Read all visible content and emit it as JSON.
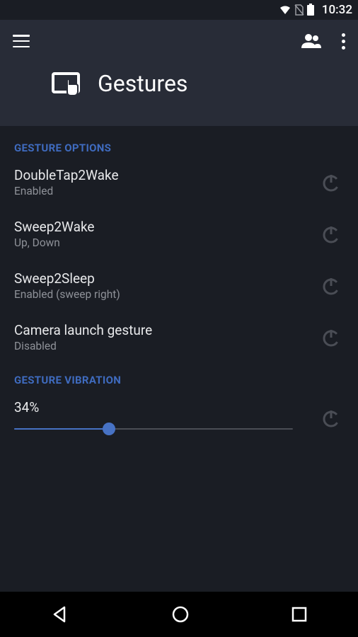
{
  "status_bar": {
    "time": "10:32"
  },
  "header": {
    "title": "Gestures"
  },
  "sections": {
    "options_header": "GESTURE OPTIONS",
    "vibration_header": "GESTURE VIBRATION"
  },
  "settings": {
    "doubletap": {
      "title": "DoubleTap2Wake",
      "sub": "Enabled"
    },
    "sweep2wake": {
      "title": "Sweep2Wake",
      "sub": "Up, Down"
    },
    "sweep2sleep": {
      "title": "Sweep2Sleep",
      "sub": "Enabled (sweep right)"
    },
    "camera": {
      "title": "Camera launch gesture",
      "sub": "Disabled"
    }
  },
  "vibration": {
    "value_label": "34%",
    "value": 34
  }
}
